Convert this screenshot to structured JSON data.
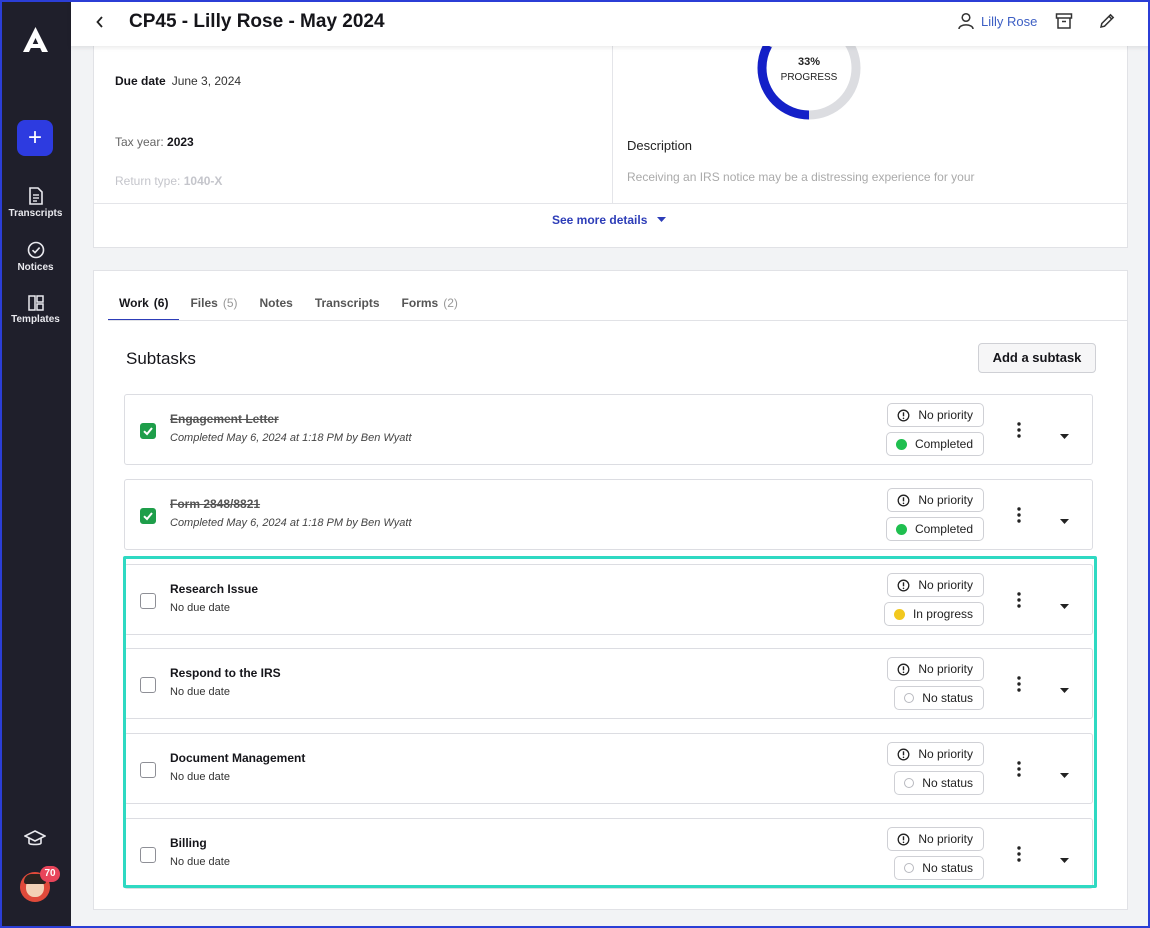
{
  "sidebar": {
    "add_label": "+",
    "items": [
      {
        "label": "Transcripts",
        "icon": "document-icon"
      },
      {
        "label": "Notices",
        "icon": "check-circle-icon"
      },
      {
        "label": "Templates",
        "icon": "templates-icon"
      }
    ],
    "avatar_badge": "70"
  },
  "header": {
    "title": "CP45 - Lilly Rose - May 2024",
    "user_name": "Lilly Rose"
  },
  "details": {
    "due_label": "Due date",
    "due_value": "June 3, 2024",
    "tax_label": "Tax year:",
    "tax_value": "2023",
    "return_label": "Return type:",
    "return_value": "1040-X",
    "progress_pct": "33%",
    "progress_fraction": 0.33,
    "progress_label": "PROGRESS",
    "description_title": "Description",
    "description_text": "Receiving an IRS notice may be a distressing experience for your",
    "see_more": "See more details"
  },
  "tabs": [
    {
      "label": "Work",
      "count": "(6)",
      "active": true
    },
    {
      "label": "Files",
      "count": "(5)",
      "active": false
    },
    {
      "label": "Notes",
      "count": "",
      "active": false
    },
    {
      "label": "Transcripts",
      "count": "",
      "active": false
    },
    {
      "label": "Forms",
      "count": "(2)",
      "active": false
    }
  ],
  "subtasks": {
    "title": "Subtasks",
    "add_label": "Add a subtask",
    "rows": [
      {
        "name": "Engagement Letter",
        "sub": "Completed May 6, 2024 at 1:18 PM by Ben Wyatt",
        "done": true,
        "priority": "No priority",
        "status": "Completed",
        "status_color": "green"
      },
      {
        "name": "Form 2848/8821",
        "sub": "Completed May 6, 2024 at 1:18 PM by Ben Wyatt",
        "done": true,
        "priority": "No priority",
        "status": "Completed",
        "status_color": "green"
      },
      {
        "name": "Research Issue",
        "sub": "No due date",
        "done": false,
        "priority": "No priority",
        "status": "In progress",
        "status_color": "yellow"
      },
      {
        "name": "Respond to the IRS",
        "sub": "No due date",
        "done": false,
        "priority": "No priority",
        "status": "No status",
        "status_color": "empty"
      },
      {
        "name": "Document Management",
        "sub": "No due date",
        "done": false,
        "priority": "No priority",
        "status": "No status",
        "status_color": "empty"
      },
      {
        "name": "Billing",
        "sub": "No due date",
        "done": false,
        "priority": "No priority",
        "status": "No status",
        "status_color": "empty"
      }
    ]
  },
  "colors": {
    "accent": "#2d3be0",
    "highlight": "#2fd9c2",
    "completed": "#1fbf4f",
    "in_progress": "#f2c81e"
  }
}
